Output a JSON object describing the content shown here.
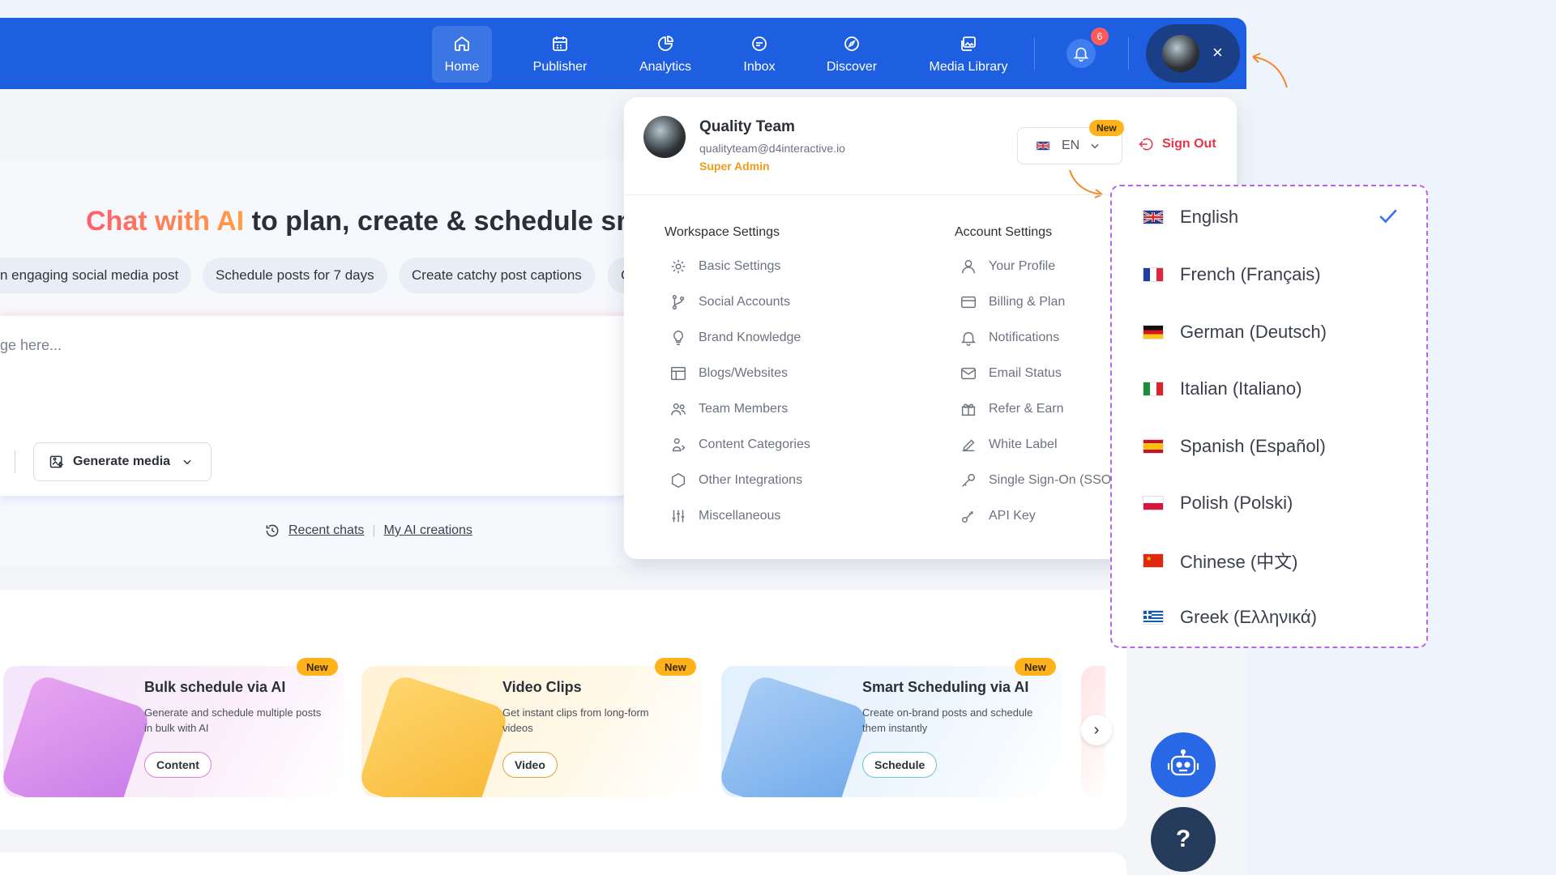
{
  "nav": {
    "items": [
      {
        "label": "Home",
        "icon": "home-icon"
      },
      {
        "label": "Publisher",
        "icon": "calendar-icon"
      },
      {
        "label": "Analytics",
        "icon": "pie-chart-icon"
      },
      {
        "label": "Inbox",
        "icon": "chat-icon"
      },
      {
        "label": "Discover",
        "icon": "compass-icon"
      },
      {
        "label": "Media Library",
        "icon": "images-icon"
      }
    ],
    "notification_count": "6",
    "close_symbol": "×"
  },
  "hero": {
    "title_highlight": "Chat with AI",
    "title_rest": " to plan, create & schedule smar",
    "chips": [
      "n engaging social media post",
      "Schedule posts for 7 days",
      "Create catchy post captions",
      "C"
    ],
    "message_placeholder": "ge here...",
    "generate_media_label": "Generate media",
    "recent_chats_label": "Recent chats",
    "ai_creations_label": "My AI creations"
  },
  "profile": {
    "name": "Quality Team",
    "email": "qualityteam@d4interactive.io",
    "role": "Super Admin",
    "language_code": "EN",
    "new_badge": "New",
    "sign_out_label": "Sign Out"
  },
  "workspace_settings": {
    "heading": "Workspace Settings",
    "items": [
      "Basic Settings",
      "Social Accounts",
      "Brand Knowledge",
      "Blogs/Websites",
      "Team Members",
      "Content Categories",
      "Other Integrations",
      "Miscellaneous"
    ]
  },
  "account_settings": {
    "heading": "Account Settings",
    "items": [
      "Your Profile",
      "Billing & Plan",
      "Notifications",
      "Email Status",
      "Refer & Earn",
      "White Label",
      "Single Sign-On (SSO",
      "API Key"
    ]
  },
  "languages": {
    "selected": "English",
    "items": [
      "English",
      "French (Français)",
      "German (Deutsch)",
      "Italian (Italiano)",
      "Spanish (Español)",
      "Polish (Polski)",
      "Chinese (中文)",
      "Greek (Ελληνικά)"
    ]
  },
  "features": [
    {
      "title": "Bulk schedule via AI",
      "desc": "Generate and schedule multiple posts in bulk with AI",
      "button": "Content",
      "badge": "New"
    },
    {
      "title": "Video Clips",
      "desc": "Get instant clips from long-form videos",
      "button": "Video",
      "badge": "New"
    },
    {
      "title": "Smart Scheduling via AI",
      "desc": "Create on-brand posts and schedule them instantly",
      "button": "Schedule",
      "badge": "New"
    }
  ],
  "help_symbol": "?",
  "colors": {
    "brand_blue": "#1d5fe0",
    "accent_orange": "#f39a16",
    "danger_red": "#e8334b",
    "badge_yellow": "#ffb21a"
  }
}
